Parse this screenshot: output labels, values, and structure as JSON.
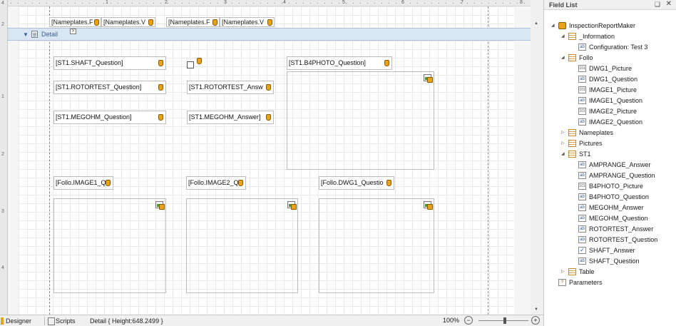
{
  "ruler": {
    "vertical_numbers": [
      "4",
      "2",
      "1",
      "2",
      "3",
      "4"
    ],
    "horizontal_numbers": [
      "1",
      "2",
      "3",
      "4",
      "5",
      "6",
      "7",
      "8"
    ]
  },
  "header_fields": [
    "[Nameplates.F",
    "[Nameplates.V",
    "[Nameplates.F",
    "[Nameplates.V"
  ],
  "detail_band": {
    "label": "Detail"
  },
  "controls": {
    "shaft_question": "[ST1.SHAFT_Question]",
    "rotortest_question": "[ST1.ROTORTEST_Question]",
    "rotortest_answer": "[ST1.ROTORTEST_Answ",
    "megohm_question": "[ST1.MEGOHM_Question]",
    "megohm_answer": "[ST1.MEGOHM_Answer]",
    "b4photo_question": "[ST1.B4PHOTO_Question]",
    "image1_q": "[Follo.IMAGE1_Q",
    "image2_q": "[Follo.IMAGE2_Q",
    "dwg1_q": "[Follo.DWG1_Questio"
  },
  "field_list": {
    "title": "Field List",
    "pin": "❑",
    "close": "✕",
    "items": [
      {
        "label": "InspectionReportMaker",
        "icon": "root-icon",
        "level": 0,
        "exp": "◢"
      },
      {
        "label": "_Information",
        "icon": "table-icon",
        "level": 1,
        "exp": "◢"
      },
      {
        "label": "Configuration: Test 3",
        "icon": "text-field-icon",
        "level": 2,
        "exp": ""
      },
      {
        "label": "Follo",
        "icon": "table-icon",
        "level": 1,
        "exp": "◢"
      },
      {
        "label": "DWG1_Picture",
        "icon": "picture-field-icon",
        "level": 2,
        "exp": ""
      },
      {
        "label": "DWG1_Question",
        "icon": "text-field-icon",
        "level": 2,
        "exp": ""
      },
      {
        "label": "IMAGE1_Picture",
        "icon": "picture-field-icon",
        "level": 2,
        "exp": ""
      },
      {
        "label": "IMAGE1_Question",
        "icon": "text-field-icon",
        "level": 2,
        "exp": ""
      },
      {
        "label": "IMAGE2_Picture",
        "icon": "picture-field-icon",
        "level": 2,
        "exp": ""
      },
      {
        "label": "IMAGE2_Question",
        "icon": "text-field-icon",
        "level": 2,
        "exp": ""
      },
      {
        "label": "Nameplates",
        "icon": "table-icon",
        "level": 1,
        "exp": "▷"
      },
      {
        "label": "Pictures",
        "icon": "table-icon",
        "level": 1,
        "exp": "▷"
      },
      {
        "label": "ST1",
        "icon": "table-icon",
        "level": 1,
        "exp": "◢"
      },
      {
        "label": "AMPRANGE_Answer",
        "icon": "text-field-icon",
        "level": 2,
        "exp": ""
      },
      {
        "label": "AMPRANGE_Question",
        "icon": "text-field-icon",
        "level": 2,
        "exp": ""
      },
      {
        "label": "B4PHOTO_Picture",
        "icon": "picture-field-icon",
        "level": 2,
        "exp": ""
      },
      {
        "label": "B4PHOTO_Question",
        "icon": "text-field-icon",
        "level": 2,
        "exp": ""
      },
      {
        "label": "MEGOHM_Answer",
        "icon": "text-field-icon",
        "level": 2,
        "exp": ""
      },
      {
        "label": "MEGOHM_Question",
        "icon": "text-field-icon",
        "level": 2,
        "exp": ""
      },
      {
        "label": "ROTORTEST_Answer",
        "icon": "text-field-icon",
        "level": 2,
        "exp": ""
      },
      {
        "label": "ROTORTEST_Question",
        "icon": "text-field-icon",
        "level": 2,
        "exp": ""
      },
      {
        "label": "SHAFT_Answer",
        "icon": "boolean-field-icon",
        "level": 2,
        "exp": ""
      },
      {
        "label": "SHAFT_Question",
        "icon": "text-field-icon",
        "level": 2,
        "exp": ""
      },
      {
        "label": "Table",
        "icon": "table-icon",
        "level": 1,
        "exp": "▷"
      },
      {
        "label": "Parameters",
        "icon": "parameters-icon",
        "level": 0,
        "exp": ""
      }
    ]
  },
  "statusbar": {
    "designer_tab": "Designer",
    "scripts_tab": "Scripts",
    "detail_info": "Detail { Height:648.2499 }",
    "zoom": "100%",
    "zoom_minus": "−",
    "zoom_plus": "+"
  },
  "colors": {
    "band": "#d9e6f4",
    "field_icon": "#e8a21a"
  }
}
